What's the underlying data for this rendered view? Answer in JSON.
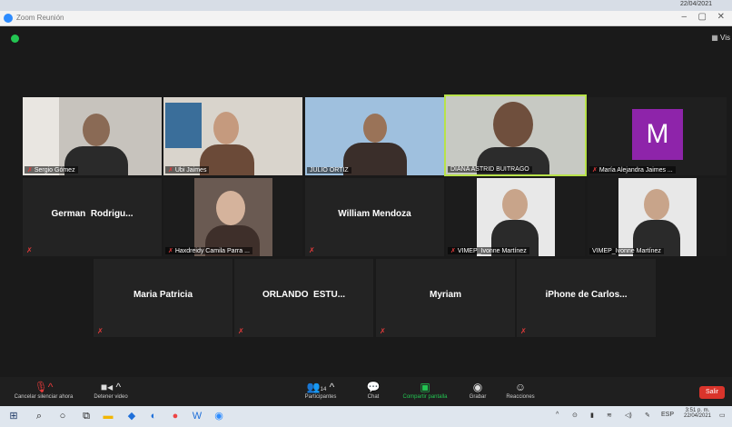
{
  "window": {
    "title": "Zoom Reunión",
    "top_date": "22/04/2021"
  },
  "view_button": "Vis",
  "tiles": [
    {
      "id": "sergio",
      "label": "Sergio Gómez",
      "name": ""
    },
    {
      "id": "ubi",
      "label": "Ubi Jaimes",
      "name": ""
    },
    {
      "id": "julio",
      "label": "JULIO ORTIZ",
      "name": ""
    },
    {
      "id": "diana",
      "label": "DIANA ASTRID BUITRAGO",
      "name": ""
    },
    {
      "id": "maria-alejandra",
      "label": "María Alejandra Jaimes ...",
      "avatar_letter": "M"
    },
    {
      "id": "german",
      "label": "",
      "name": "German  Rodrigu..."
    },
    {
      "id": "haxdreidy",
      "label": "Haxdreidy Camila Parra ...",
      "name": ""
    },
    {
      "id": "william",
      "label": "",
      "name": "William Mendoza"
    },
    {
      "id": "vimep1",
      "label": "VIMEP_Ivonne Martínez",
      "name": ""
    },
    {
      "id": "vimep2",
      "label": "VIMEP_Ivonne Martínez",
      "name": ""
    },
    {
      "id": "maria-patricia",
      "label": "",
      "name": "Maria Patricia"
    },
    {
      "id": "orlando",
      "label": "",
      "name": "ORLANDO  ESTU..."
    },
    {
      "id": "myriam",
      "label": "",
      "name": "Myriam"
    },
    {
      "id": "iphone",
      "label": "",
      "name": "iPhone de Carlos..."
    }
  ],
  "toolbar": {
    "mute": "Cancelar silenciar ahora",
    "video": "Detener video",
    "participants": "Participantes",
    "participants_count": "14",
    "chat": "Chat",
    "share": "Compartir pantalla",
    "record": "Grabar",
    "reactions": "Reacciones",
    "end": "Salir"
  },
  "taskbar": {
    "lang": "ESP",
    "time": "3:51 p. m.",
    "date": "22/04/2021"
  },
  "colors": {
    "accent": "#23c552",
    "active_speaker": "#b8e24a",
    "end_button": "#d9342b",
    "avatar_bg": "#8e24aa"
  }
}
